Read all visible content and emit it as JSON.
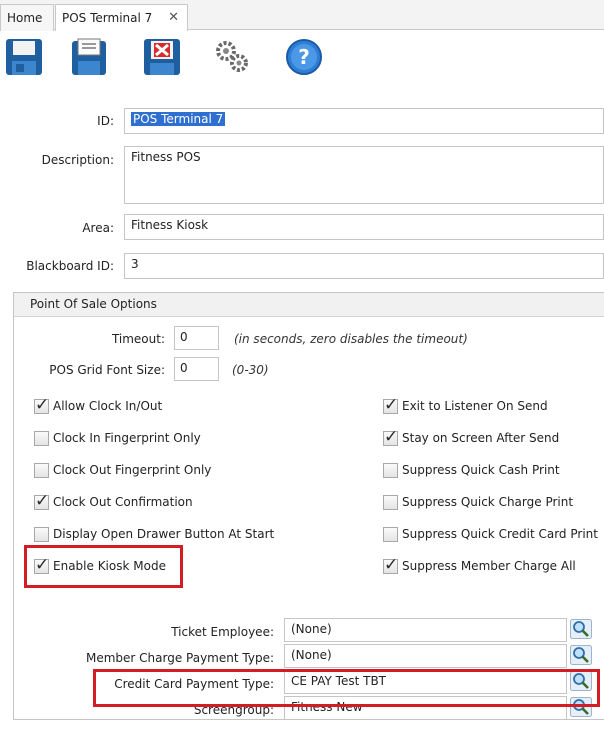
{
  "tabs": [
    {
      "label": "Home"
    },
    {
      "label": "POS Terminal 7",
      "close": "✕"
    }
  ],
  "toolbar": [
    {
      "name": "save-icon"
    },
    {
      "name": "save-copy-icon"
    },
    {
      "name": "delete-icon"
    },
    {
      "name": "settings-gears-icon"
    },
    {
      "name": "help-icon"
    }
  ],
  "form": {
    "id_label": "ID:",
    "id_value": "POS Terminal 7",
    "description_label": "Description:",
    "description_value": "Fitness POS",
    "area_label": "Area:",
    "area_value": "Fitness Kiosk",
    "blackboard_label": "Blackboard ID:",
    "blackboard_value": "3"
  },
  "pos_options": {
    "title": "Point Of Sale Options",
    "timeout_label": "Timeout:",
    "timeout_value": "0",
    "timeout_hint": "(in seconds, zero disables the timeout)",
    "font_label": "POS Grid Font Size:",
    "font_value": "0",
    "font_hint": "(0-30)",
    "left_checks": [
      {
        "label": "Allow Clock In/Out",
        "checked": true
      },
      {
        "label": "Clock In Fingerprint Only",
        "checked": false
      },
      {
        "label": "Clock Out Fingerprint Only",
        "checked": false
      },
      {
        "label": "Clock Out Confirmation",
        "checked": true
      },
      {
        "label": "Display Open Drawer Button At Start",
        "checked": false
      },
      {
        "label": "Enable Kiosk Mode",
        "checked": true
      }
    ],
    "right_checks": [
      {
        "label": "Exit to Listener On Send",
        "checked": true
      },
      {
        "label": "Stay on Screen After Send",
        "checked": true
      },
      {
        "label": "Suppress Quick Cash Print",
        "checked": false
      },
      {
        "label": "Suppress Quick Charge Print",
        "checked": false
      },
      {
        "label": "Suppress Quick Credit Card Print",
        "checked": false
      },
      {
        "label": "Suppress Member Charge All",
        "checked": true
      }
    ],
    "lookups": [
      {
        "label": "Ticket Employee:",
        "value": "(None)"
      },
      {
        "label": "Member Charge Payment Type:",
        "value": "(None)"
      },
      {
        "label": "Credit Card Payment Type:",
        "value": "CE PAY Test TBT"
      },
      {
        "label": "Screengroup:",
        "value": "Fitness New"
      }
    ]
  },
  "colors": {
    "highlight": "#d21d24",
    "selection": "#2f6fd0"
  }
}
